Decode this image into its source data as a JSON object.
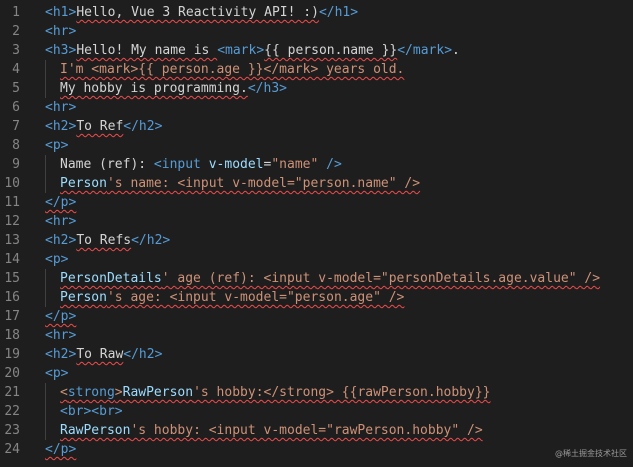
{
  "editor": {
    "lines": [
      {
        "n": "1",
        "indent": 0,
        "tokens": [
          {
            "t": "<h1>",
            "c": "tag"
          },
          {
            "t": "Hello, Vue 3 Reactivity API! :)",
            "c": "txt",
            "sq": true
          },
          {
            "t": "</h1>",
            "c": "tag"
          }
        ]
      },
      {
        "n": "2",
        "indent": 0,
        "tokens": [
          {
            "t": "<hr>",
            "c": "tag"
          }
        ]
      },
      {
        "n": "3",
        "indent": 0,
        "tokens": [
          {
            "t": "<h3>",
            "c": "tag"
          },
          {
            "t": "Hello! My name is ",
            "c": "txt",
            "sq": true
          },
          {
            "t": "<mark>",
            "c": "tag"
          },
          {
            "t": "{{ person.name }}",
            "c": "txt",
            "sq": true
          },
          {
            "t": "</mark>",
            "c": "tag"
          },
          {
            "t": ".",
            "c": "txt"
          }
        ]
      },
      {
        "n": "4",
        "indent": 1,
        "tokens": [
          {
            "t": "I'm <mark>{{ person.age }}</mark> years old.",
            "c": "str",
            "sq": true
          }
        ]
      },
      {
        "n": "5",
        "indent": 1,
        "tokens": [
          {
            "t": "My hobby is programming.",
            "c": "txt",
            "sq": true
          },
          {
            "t": "</h3>",
            "c": "tag"
          }
        ]
      },
      {
        "n": "6",
        "indent": 0,
        "tokens": [
          {
            "t": "<hr>",
            "c": "tag"
          }
        ]
      },
      {
        "n": "7",
        "indent": 0,
        "tokens": [
          {
            "t": "<h2>",
            "c": "tag"
          },
          {
            "t": "To Ref",
            "c": "txt",
            "sq": true
          },
          {
            "t": "</h2>",
            "c": "tag"
          }
        ]
      },
      {
        "n": "8",
        "indent": 0,
        "tokens": [
          {
            "t": "<p>",
            "c": "tag"
          }
        ]
      },
      {
        "n": "9",
        "indent": 1,
        "tokens": [
          {
            "t": "Name (ref): ",
            "c": "txt"
          },
          {
            "t": "<input ",
            "c": "tag"
          },
          {
            "t": "v-model",
            "c": "attr"
          },
          {
            "t": "=",
            "c": "txt"
          },
          {
            "t": "\"name\"",
            "c": "str"
          },
          {
            "t": " />",
            "c": "tag"
          }
        ]
      },
      {
        "n": "10",
        "indent": 1,
        "tokens": [
          {
            "t": "Person",
            "c": "attr",
            "sq": true
          },
          {
            "t": "'s name: <input v-model=\"person.name\" />",
            "c": "str",
            "sq": true
          }
        ]
      },
      {
        "n": "11",
        "indent": 0,
        "tokens": [
          {
            "t": "</p>",
            "c": "tag",
            "sq": true
          }
        ]
      },
      {
        "n": "12",
        "indent": 0,
        "tokens": [
          {
            "t": "<hr>",
            "c": "tag"
          }
        ]
      },
      {
        "n": "13",
        "indent": 0,
        "tokens": [
          {
            "t": "<h2>",
            "c": "tag"
          },
          {
            "t": "To Refs",
            "c": "txt",
            "sq": true
          },
          {
            "t": "</h2>",
            "c": "tag"
          }
        ]
      },
      {
        "n": "14",
        "indent": 0,
        "tokens": [
          {
            "t": "<p>",
            "c": "tag"
          }
        ]
      },
      {
        "n": "15",
        "indent": 1,
        "tokens": [
          {
            "t": "PersonDetails",
            "c": "attr",
            "sq": true
          },
          {
            "t": "' age (ref): <input v-model=\"personDetails.age.value\" />",
            "c": "str",
            "sq": true
          }
        ]
      },
      {
        "n": "16",
        "indent": 1,
        "tokens": [
          {
            "t": "Person",
            "c": "attr",
            "sq": true
          },
          {
            "t": "'s age: <input v-model=\"person.age\" />",
            "c": "str",
            "sq": true
          }
        ]
      },
      {
        "n": "17",
        "indent": 0,
        "tokens": [
          {
            "t": "</p>",
            "c": "tag",
            "sq": true
          }
        ]
      },
      {
        "n": "18",
        "indent": 0,
        "tokens": [
          {
            "t": "<hr>",
            "c": "tag"
          }
        ]
      },
      {
        "n": "19",
        "indent": 0,
        "tokens": [
          {
            "t": "<h2>",
            "c": "tag"
          },
          {
            "t": "To Raw",
            "c": "txt",
            "sq": true
          },
          {
            "t": "</h2>",
            "c": "tag"
          }
        ]
      },
      {
        "n": "20",
        "indent": 0,
        "tokens": [
          {
            "t": "<p>",
            "c": "tag"
          }
        ]
      },
      {
        "n": "21",
        "indent": 1,
        "tokens": [
          {
            "t": "<",
            "c": "str",
            "sq": true
          },
          {
            "t": "strong",
            "c": "tag",
            "sq": true
          },
          {
            "t": ">",
            "c": "str",
            "sq": true
          },
          {
            "t": "RawPerson",
            "c": "attr",
            "sq": true
          },
          {
            "t": "'s hobby:</strong> {{rawPerson.hobby}}",
            "c": "str",
            "sq": true
          }
        ]
      },
      {
        "n": "22",
        "indent": 1,
        "tokens": [
          {
            "t": "<br><br>",
            "c": "tag"
          }
        ]
      },
      {
        "n": "23",
        "indent": 1,
        "tokens": [
          {
            "t": "RawPerson",
            "c": "attr",
            "sq": true
          },
          {
            "t": "'s hobby: <input v-model=\"rawPerson.hobby\" />",
            "c": "str",
            "sq": true
          }
        ]
      },
      {
        "n": "24",
        "indent": 0,
        "tokens": [
          {
            "t": "</p>",
            "c": "tag",
            "sq": true
          }
        ]
      }
    ]
  },
  "watermark": "@稀土掘金技术社区",
  "colors": {
    "background": "#1e1e1e",
    "line_number": "#858585",
    "tag": "#569cd6",
    "text": "#d4d4d4",
    "attribute": "#9cdcfe",
    "string": "#ce9178",
    "squiggle": "#f14c4c"
  }
}
